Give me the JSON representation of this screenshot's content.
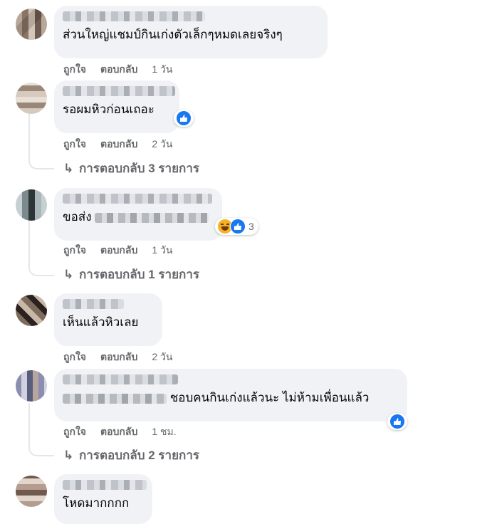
{
  "actions": {
    "like": "ถูกใจ",
    "reply": "ตอบกลับ"
  },
  "comments": [
    {
      "text": "ส่วนใหญ่แชมป์กินเก่งตัวเล็กๆหมดเลยจริงๆ",
      "time": "1 วัน"
    },
    {
      "text": "รอผมหิวก่อนเถอะ",
      "time": "2 วัน",
      "replies": "การตอบกลับ 3 รายการ",
      "reactions": [
        "like-icon"
      ]
    },
    {
      "text": "ขอส่ง",
      "time": "1 วัน",
      "replies": "การตอบกลับ 1 รายการ",
      "reactions": [
        "haha-icon",
        "like-icon"
      ],
      "reaction_count": "3"
    },
    {
      "text": "เห็นแล้วหิวเลย",
      "time": "2 วัน"
    },
    {
      "text": "ชอบคนกินเก่งแล้วนะ ไม่ห้ามเพื่อนแล้ว",
      "time": "1 ชม.",
      "replies": "การตอบกลับ 2 รายการ",
      "reactions": [
        "like-icon"
      ]
    },
    {
      "text": "โหดมากกกก"
    }
  ],
  "colors": {
    "bubble": "#f0f2f5",
    "meta_text": "#65676b",
    "like_blue": "#1877f2",
    "haha_yellow": "#f7b125"
  }
}
